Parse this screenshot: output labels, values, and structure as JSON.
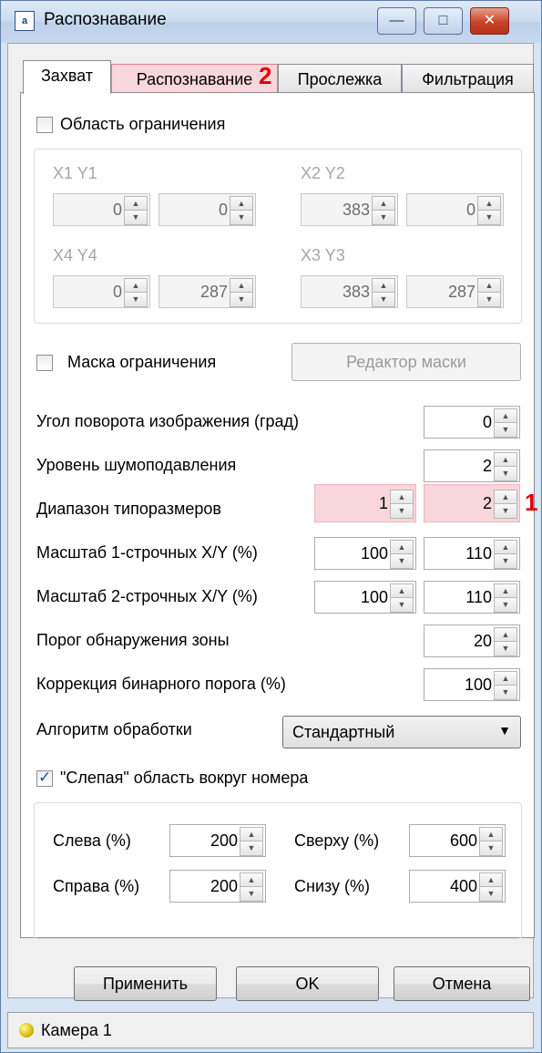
{
  "window": {
    "title": "Распознавание",
    "icon_text": "a",
    "buttons": {
      "minimize": "—",
      "maximize": "□",
      "close": "✕"
    }
  },
  "tabs": [
    {
      "label": "Захват",
      "active": true
    },
    {
      "label": "Распознавание",
      "active": false
    },
    {
      "label": "Прослежка",
      "active": false
    },
    {
      "label": "Фильтрация",
      "active": false
    }
  ],
  "markers": {
    "tab": "2",
    "row": "1"
  },
  "area": {
    "checkbox_label": "Область ограничения",
    "checked": false,
    "x1y1_label": "X1 Y1",
    "x2y2_label": "X2 Y2",
    "x4y4_label": "X4 Y4",
    "x3y3_label": "X3 Y3",
    "x1": "0",
    "y1": "0",
    "x2": "383",
    "y2": "0",
    "x4": "0",
    "y4": "287",
    "x3": "383",
    "y3": "287"
  },
  "mask": {
    "checkbox_label": "Маска ограничения",
    "checked": false,
    "editor_button": "Редактор маски"
  },
  "fields": {
    "rotation_label": "Угол поворота изображения (град)",
    "rotation": "0",
    "noise_label": "Уровень шумоподавления",
    "noise": "2",
    "size_range_label": "Диапазон типоразмеров",
    "size_min": "1",
    "size_max": "2",
    "scale1_label": "Масштаб 1-строчных X/Y (%)",
    "scale1_x": "100",
    "scale1_y": "110",
    "scale2_label": "Масштаб 2-строчных X/Y (%)",
    "scale2_x": "100",
    "scale2_y": "110",
    "zone_label": "Порог обнаружения зоны",
    "zone": "20",
    "binary_label": "Коррекция бинарного порога (%)",
    "binary": "100",
    "algorithm_label": "Алгоритм обработки",
    "algorithm": "Стандартный"
  },
  "blind": {
    "checkbox_label": "\"Слепая\" область вокруг номера",
    "checked": true,
    "left_label": "Слева (%)",
    "left": "200",
    "top_label": "Сверху (%)",
    "top": "600",
    "right_label": "Справа (%)",
    "right": "200",
    "bottom_label": "Снизу (%)",
    "bottom": "400"
  },
  "buttons": {
    "apply": "Применить",
    "ok": "OK",
    "cancel": "Отмена"
  },
  "status": {
    "camera": "Камера 1"
  },
  "colors": {
    "highlight": "#f8d6dc",
    "marker": "#e00000",
    "accent": "#2150a8"
  }
}
